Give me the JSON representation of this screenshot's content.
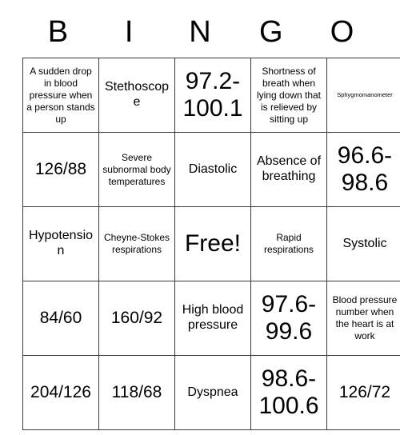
{
  "card": {
    "header_letters": [
      "B",
      "I",
      "N",
      "G",
      "O"
    ],
    "rows": [
      [
        {
          "text": "A sudden drop in blood pressure when a person stands up",
          "size": "sm"
        },
        {
          "text": "Stethoscope",
          "size": "md"
        },
        {
          "text": "97.2-100.1",
          "size": "xl"
        },
        {
          "text": "Shortness of breath when lying down that is relieved by sitting up",
          "size": "sm"
        },
        {
          "text": "Sphygmomanometer",
          "size": "xs"
        }
      ],
      [
        {
          "text": "126/88",
          "size": "lg"
        },
        {
          "text": "Severe subnormal body temperatures",
          "size": "sm"
        },
        {
          "text": "Diastolic",
          "size": "md"
        },
        {
          "text": "Absence of breathing",
          "size": "md"
        },
        {
          "text": "96.6-98.6",
          "size": "xl"
        }
      ],
      [
        {
          "text": "Hypotension",
          "size": "md"
        },
        {
          "text": "Cheyne-Stokes respirations",
          "size": "sm"
        },
        {
          "text": "Free!",
          "size": "xl"
        },
        {
          "text": "Rapid respirations",
          "size": "sm"
        },
        {
          "text": "Systolic",
          "size": "md"
        }
      ],
      [
        {
          "text": "84/60",
          "size": "lg"
        },
        {
          "text": "160/92",
          "size": "lg"
        },
        {
          "text": "High blood pressure",
          "size": "md"
        },
        {
          "text": "97.6-99.6",
          "size": "xl"
        },
        {
          "text": "Blood pressure number when the heart is at work",
          "size": "sm"
        }
      ],
      [
        {
          "text": "204/126",
          "size": "lg"
        },
        {
          "text": "118/68",
          "size": "lg"
        },
        {
          "text": "Dyspnea",
          "size": "md"
        },
        {
          "text": "98.6-100.6",
          "size": "xl"
        },
        {
          "text": "126/72",
          "size": "lg"
        }
      ]
    ]
  },
  "colors": {
    "background": "#ffffff",
    "text": "#000000",
    "grid_border": "#3a3a3a"
  }
}
